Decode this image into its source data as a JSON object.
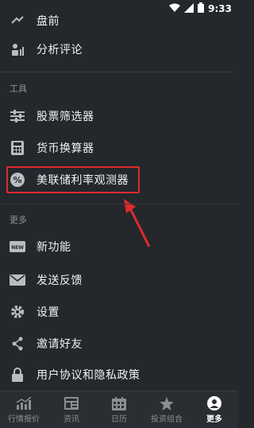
{
  "status_bar": {
    "time": "9:33"
  },
  "menu": {
    "partial_top_item": "盘前",
    "analysis_item": "分析评论",
    "tools_section": "工具",
    "tools": [
      "股票筛选器",
      "货币换算器",
      "美联储利率观测器"
    ],
    "more_section": "更多",
    "more": [
      "新功能",
      "发送反馈",
      "设置",
      "邀请好友",
      "用户协议和隐私政策"
    ]
  },
  "tabs": [
    {
      "label": "行情报价",
      "icon": "chart-icon"
    },
    {
      "label": "资讯",
      "icon": "news-icon"
    },
    {
      "label": "日历",
      "icon": "calendar-icon"
    },
    {
      "label": "投资组合",
      "icon": "star-icon"
    },
    {
      "label": "更多",
      "icon": "more-icon"
    }
  ],
  "colors": {
    "background": "#24272c",
    "highlight": "#e02b2b"
  }
}
